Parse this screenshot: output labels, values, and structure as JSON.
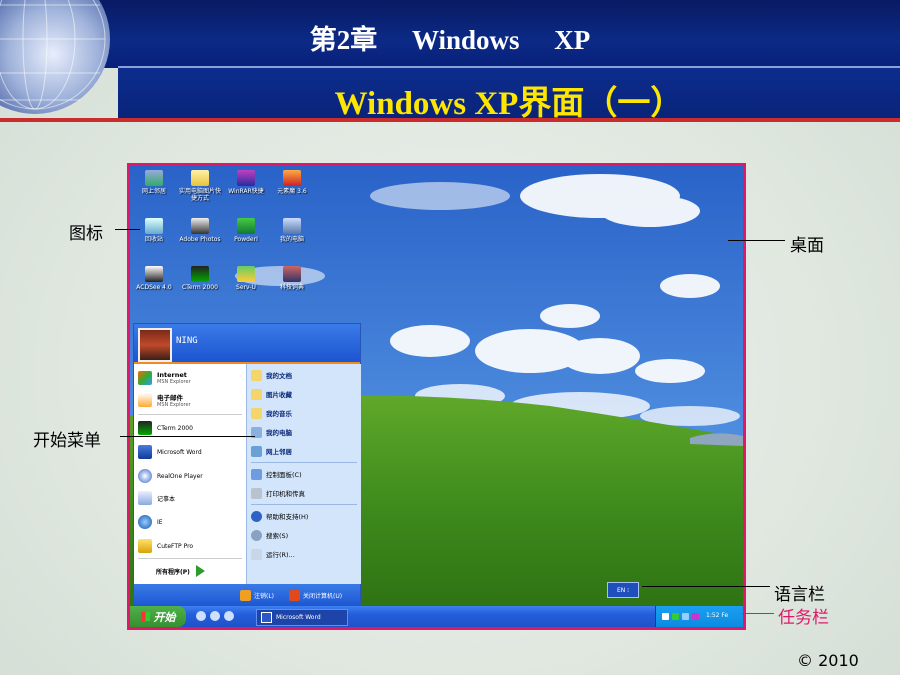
{
  "slide": {
    "chapter": "第2章",
    "product": "Windows XP",
    "subtitle": "Windows XP界面（一）",
    "copyright": "© 2010"
  },
  "callouts": {
    "icons": "图标",
    "desktop": "桌面",
    "start_menu": "开始菜单",
    "language_bar": "语言栏",
    "taskbar": "任务栏"
  },
  "colors": {
    "header": "#0b2a86",
    "subtitle": "#ffe600",
    "frame_border": "#e0186a",
    "taskbar": "#245edb",
    "start_button": "#3c9a35"
  },
  "desktop_icons": [
    {
      "label": "网上邻居",
      "icon": "network-icon"
    },
    {
      "label": "实用电脑图片快捷方式",
      "icon": "folder-icon"
    },
    {
      "label": "WinRAR快捷",
      "icon": "winrar-icon"
    },
    {
      "label": "元素魔 3.6",
      "icon": "app-icon"
    },
    {
      "label": "回收站",
      "icon": "recycle-bin-icon"
    },
    {
      "label": "Adobe Photos",
      "icon": "photoshop-icon"
    },
    {
      "label": "PowderI",
      "icon": "app-icon"
    },
    {
      "label": "我的电脑",
      "icon": "computer-icon"
    },
    {
      "label": "ACDSee 4.0",
      "icon": "acdsee-icon"
    },
    {
      "label": "CTerm 2000",
      "icon": "terminal-icon"
    },
    {
      "label": "Serv-U",
      "icon": "server-icon"
    },
    {
      "label": "科技词典",
      "icon": "dictionary-icon"
    }
  ],
  "start_menu": {
    "user": "NING",
    "pinned": [
      {
        "title": "Internet",
        "sub": "MSN Explorer"
      },
      {
        "title": "电子邮件",
        "sub": "MSN Explorer"
      }
    ],
    "recent": [
      "CTerm 2000",
      "Microsoft Word",
      "RealOne Player",
      "记事本",
      "IE",
      "CuteFTP Pro"
    ],
    "all_programs": "所有程序(P)",
    "places": [
      "我的文档",
      "图片收藏",
      "我的音乐",
      "我的电脑",
      "网上邻居"
    ],
    "settings": [
      "控制面板(C)",
      "打印机和传真"
    ],
    "tools": [
      "帮助和支持(H)",
      "搜索(S)",
      "运行(R)..."
    ],
    "logoff": "注销(L)",
    "shutdown": "关闭计算机(U)"
  },
  "taskbar": {
    "start_label": "开始",
    "task": "Microsoft Word",
    "clock": "1:52 Fe",
    "lang": "EN"
  }
}
